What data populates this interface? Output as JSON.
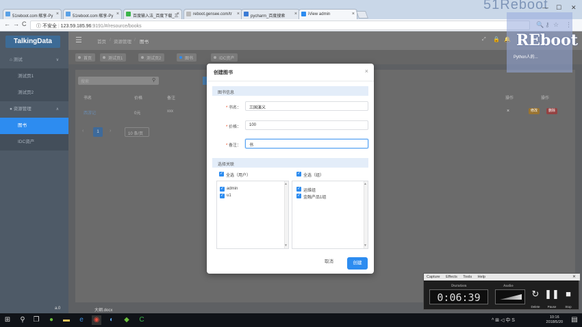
{
  "browser": {
    "tabs": [
      {
        "label": "51reboot.com 献享-Py",
        "favicon_color": "#5aa1e6"
      },
      {
        "label": "51reboot.com 献享-Py",
        "favicon_color": "#5aa1e6"
      },
      {
        "label": "百度输入法_百度下载_三",
        "favicon_color": "#3bb54a"
      },
      {
        "label": "reboot.gensee.com/tr",
        "favicon_color": "#999999"
      },
      {
        "label": "pycharm_百度搜索",
        "favicon_color": "#3a7bd5"
      },
      {
        "label": "iView admin",
        "favicon_color": "#2d8cf0"
      }
    ],
    "window_controls": {
      "min": "—",
      "max": "☐",
      "close": "✕"
    },
    "security_label": "不安全",
    "url_host": "123.59.185.96",
    "url_path": ":9191/#/resource/books",
    "nav_icons": {
      "back": "←",
      "forward": "→",
      "reload": "C",
      "info": "ⓘ"
    },
    "toolbar_icons": {
      "zoom": "🔍",
      "key": "⚷",
      "star": "☆",
      "menu": "⋮"
    }
  },
  "sidebar": {
    "logo": "TalkingData",
    "items": [
      {
        "label": "测试",
        "type": "group",
        "icon": "⌂",
        "caret": "∨"
      },
      {
        "label": "测试页1",
        "type": "sub"
      },
      {
        "label": "测试页2",
        "type": "sub"
      },
      {
        "label": "资源管理",
        "type": "group",
        "icon": "●",
        "caret": "∧"
      },
      {
        "label": "图书",
        "type": "sub",
        "active": true
      },
      {
        "label": "IDC资产",
        "type": "sub"
      }
    ]
  },
  "header": {
    "menu_icon": "☰",
    "breadcrumb": [
      "首页",
      "资源管理",
      "图书"
    ]
  },
  "tags": [
    "首页",
    "测试页1",
    "测试页2",
    "图书",
    "IDC资产"
  ],
  "background_table": {
    "search_placeholder": "搜索",
    "columns": [
      "书名",
      "价格",
      "备注",
      "操作",
      "操作"
    ],
    "row": {
      "name": "西游记",
      "price": "0元",
      "note": "xxx",
      "mark": "×",
      "edit": "修改",
      "delete": "删除"
    },
    "page": "1",
    "page_size": "10 条/页"
  },
  "modal": {
    "title": "创建图书",
    "close_icon": "×",
    "section_info": "图书信息",
    "fields": [
      {
        "label": "书名",
        "value": "三国演义"
      },
      {
        "label": "价格",
        "value": "100"
      },
      {
        "label": "备注",
        "value": "书"
      }
    ],
    "section_relation": "选择关联",
    "left_list": {
      "all_label": "全选（用户）",
      "items": [
        "admin",
        "u1"
      ]
    },
    "right_list": {
      "all_label": "全选（组）",
      "items": [
        "运维组",
        "金融产品1组"
      ]
    },
    "cancel_label": "取消",
    "create_label": "创建"
  },
  "recorder": {
    "menu": [
      "Capture",
      "Effects",
      "Tools",
      "Help"
    ],
    "duration_label": "Duration",
    "duration": "0:06:39",
    "audio_label": "Audio",
    "buttons": [
      {
        "label": "Delete",
        "icon": "↻"
      },
      {
        "label": "Pause",
        "icon": "❚❚"
      },
      {
        "label": "Stop",
        "icon": "■"
      }
    ]
  },
  "taskbar": {
    "time": "10:16",
    "date": "2018/5/20",
    "desktop_labels": [
      "a.0",
      "大纲.docx"
    ],
    "tray_icons": "^ ⊞ ◁ 中 S"
  },
  "watermark": {
    "text": "REboot",
    "sub": "Python人的..."
  },
  "colors": {
    "accent": "#2d8cf0",
    "sidebar": "#4e5a67",
    "create_button": "#2d8cf0",
    "edit_button": "#ff9900",
    "delete_button": "#ed4014"
  }
}
